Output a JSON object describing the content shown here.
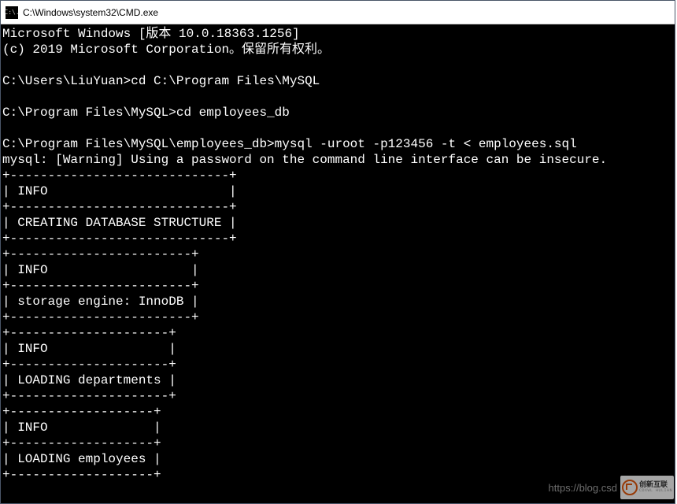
{
  "window": {
    "icon_label": "C:\\.",
    "title": "C:\\Windows\\system32\\CMD.exe"
  },
  "terminal": {
    "header_line1": "Microsoft Windows [版本 10.0.18363.1256]",
    "header_line2": "(c) 2019 Microsoft Corporation。保留所有权利。",
    "prompt1": "C:\\Users\\LiuYuan>",
    "cmd1": "cd C:\\Program Files\\MySQL",
    "prompt2": "C:\\Program Files\\MySQL>",
    "cmd2": "cd employees_db",
    "prompt3": "C:\\Program Files\\MySQL\\employees_db>",
    "cmd3": "mysql -uroot -p123456 -t < employees.sql",
    "warning": "mysql: [Warning] Using a password on the command line interface can be insecure.",
    "table1_border": "+-----------------------------+",
    "table1_header": "| INFO                        |",
    "table1_row": "| CREATING DATABASE STRUCTURE |",
    "table2_border": "+------------------------+",
    "table2_header": "| INFO                   |",
    "table2_row": "| storage engine: InnoDB |",
    "table3_border": "+---------------------+",
    "table3_header": "| INFO                |",
    "table3_row": "| LOADING departments |",
    "table4_border": "+-------------------+",
    "table4_header": "| INFO              |",
    "table4_row": "| LOADING employees |"
  },
  "watermark": {
    "text": "https://blog.csd",
    "logo_main": "创新互联",
    "logo_sub": "CDXWL HULIAN"
  }
}
